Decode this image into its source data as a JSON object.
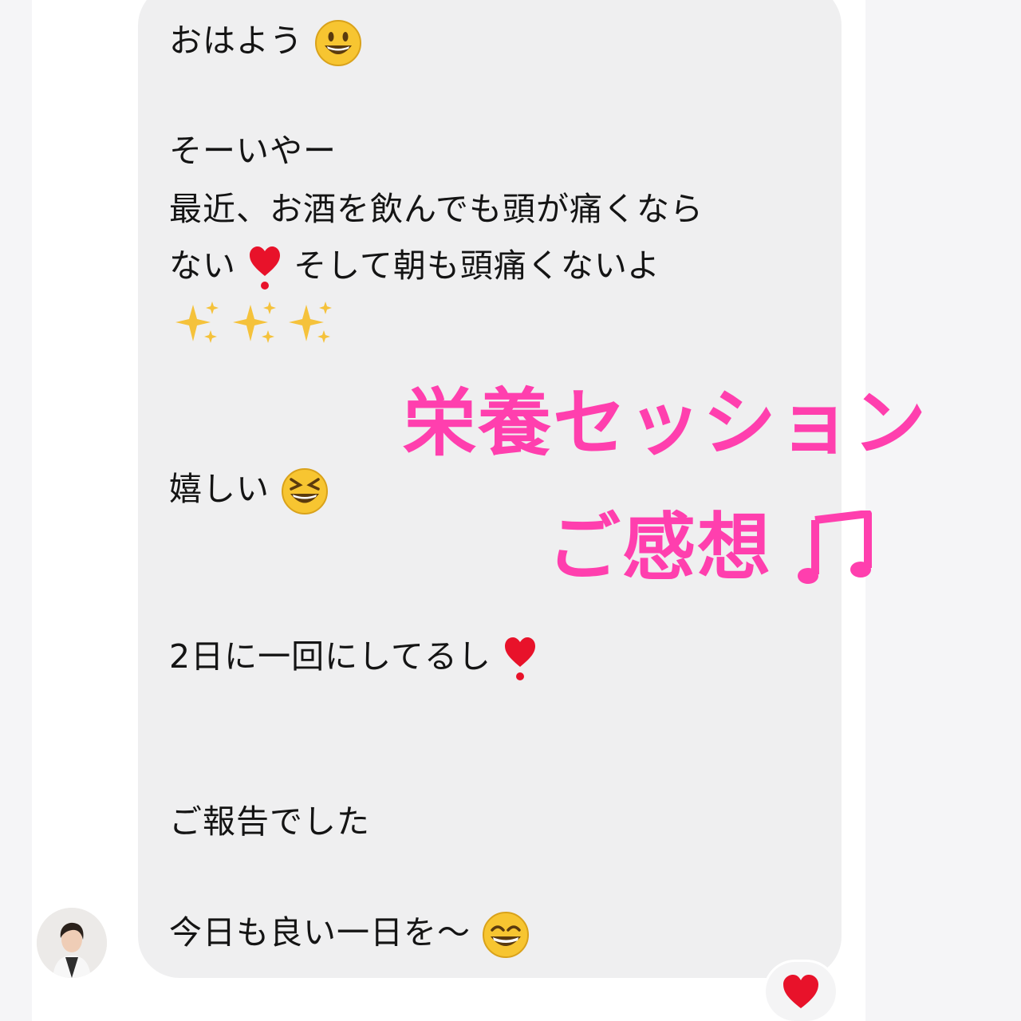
{
  "message": {
    "line1": "おはよう",
    "line2": "そーいやー",
    "line3": "最近、お酒を飲んでも頭が痛くなら",
    "line4a": "ない",
    "line4b": "そして朝も頭痛くないよ",
    "line5": "嬉しい",
    "line6": "2日に一回にしてるし",
    "line7": "ご報告でした",
    "line8": "今日も良い一日を〜"
  },
  "overlay": {
    "title_line1": "栄養セッション",
    "title_line2": "ご感想",
    "color": "#ff3fae"
  },
  "icons": [
    "smiley-icon",
    "exclamation-heart-icon",
    "sparkles-icon",
    "laughing-face-icon",
    "grinning-face-icon",
    "heart-icon",
    "music-note-icon"
  ],
  "colors": {
    "bubble": "#efeff0",
    "text": "#141414",
    "heart": "#e8122a"
  }
}
